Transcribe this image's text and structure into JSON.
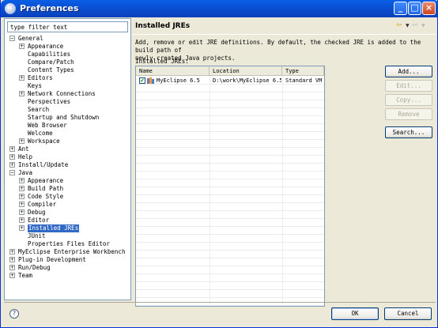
{
  "window": {
    "title": "Preferences"
  },
  "filter": {
    "placeholder": "type filter text"
  },
  "tree": [
    {
      "label": "General",
      "level": 0,
      "expander": "−"
    },
    {
      "label": "Appearance",
      "level": 1,
      "expander": "+"
    },
    {
      "label": "Capabilities",
      "level": 1,
      "expander": ""
    },
    {
      "label": "Compare/Patch",
      "level": 1,
      "expander": ""
    },
    {
      "label": "Content Types",
      "level": 1,
      "expander": ""
    },
    {
      "label": "Editors",
      "level": 1,
      "expander": "+"
    },
    {
      "label": "Keys",
      "level": 1,
      "expander": ""
    },
    {
      "label": "Network Connections",
      "level": 1,
      "expander": "+"
    },
    {
      "label": "Perspectives",
      "level": 1,
      "expander": ""
    },
    {
      "label": "Search",
      "level": 1,
      "expander": ""
    },
    {
      "label": "Startup and Shutdown",
      "level": 1,
      "expander": ""
    },
    {
      "label": "Web Browser",
      "level": 1,
      "expander": ""
    },
    {
      "label": "Welcome",
      "level": 1,
      "expander": ""
    },
    {
      "label": "Workspace",
      "level": 1,
      "expander": "+"
    },
    {
      "label": "Ant",
      "level": 0,
      "expander": "+"
    },
    {
      "label": "Help",
      "level": 0,
      "expander": "+"
    },
    {
      "label": "Install/Update",
      "level": 0,
      "expander": "+"
    },
    {
      "label": "Java",
      "level": 0,
      "expander": "−"
    },
    {
      "label": "Appearance",
      "level": 1,
      "expander": "+"
    },
    {
      "label": "Build Path",
      "level": 1,
      "expander": "+"
    },
    {
      "label": "Code Style",
      "level": 1,
      "expander": "+"
    },
    {
      "label": "Compiler",
      "level": 1,
      "expander": "+"
    },
    {
      "label": "Debug",
      "level": 1,
      "expander": "+"
    },
    {
      "label": "Editor",
      "level": 1,
      "expander": "+"
    },
    {
      "label": "Installed JREs",
      "level": 1,
      "expander": "+",
      "selected": true
    },
    {
      "label": "JUnit",
      "level": 1,
      "expander": ""
    },
    {
      "label": "Properties Files Editor",
      "level": 1,
      "expander": ""
    },
    {
      "label": "MyEclipse Enterprise Workbench",
      "level": 0,
      "expander": "+"
    },
    {
      "label": "Plug-in Development",
      "level": 0,
      "expander": "+"
    },
    {
      "label": "Run/Debug",
      "level": 0,
      "expander": "+"
    },
    {
      "label": "Team",
      "level": 0,
      "expander": "+"
    }
  ],
  "page": {
    "title": "Installed JREs",
    "description_line1": "Add, remove or edit JRE definitions. By default, the checked JRE is added to the build path of",
    "description_line2": "newly created Java projects.",
    "list_label": "Installed JREs:"
  },
  "table": {
    "headers": [
      "Name",
      "Location",
      "Type"
    ],
    "rows": [
      {
        "checked": true,
        "name": "MyEclipse 6.5",
        "location": "D:\\work\\MyEclipse 6.5",
        "type": "Standard VM"
      }
    ]
  },
  "buttons": {
    "add": "Add...",
    "edit": "Edit...",
    "copy": "Copy...",
    "remove": "Remove",
    "search": "Search...",
    "ok": "OK",
    "cancel": "Cancel"
  },
  "icons": {
    "nav_back": "back-arrow-icon",
    "nav_forward": "forward-arrow-icon",
    "help": "help-icon",
    "jre": "jre-library-icon"
  }
}
